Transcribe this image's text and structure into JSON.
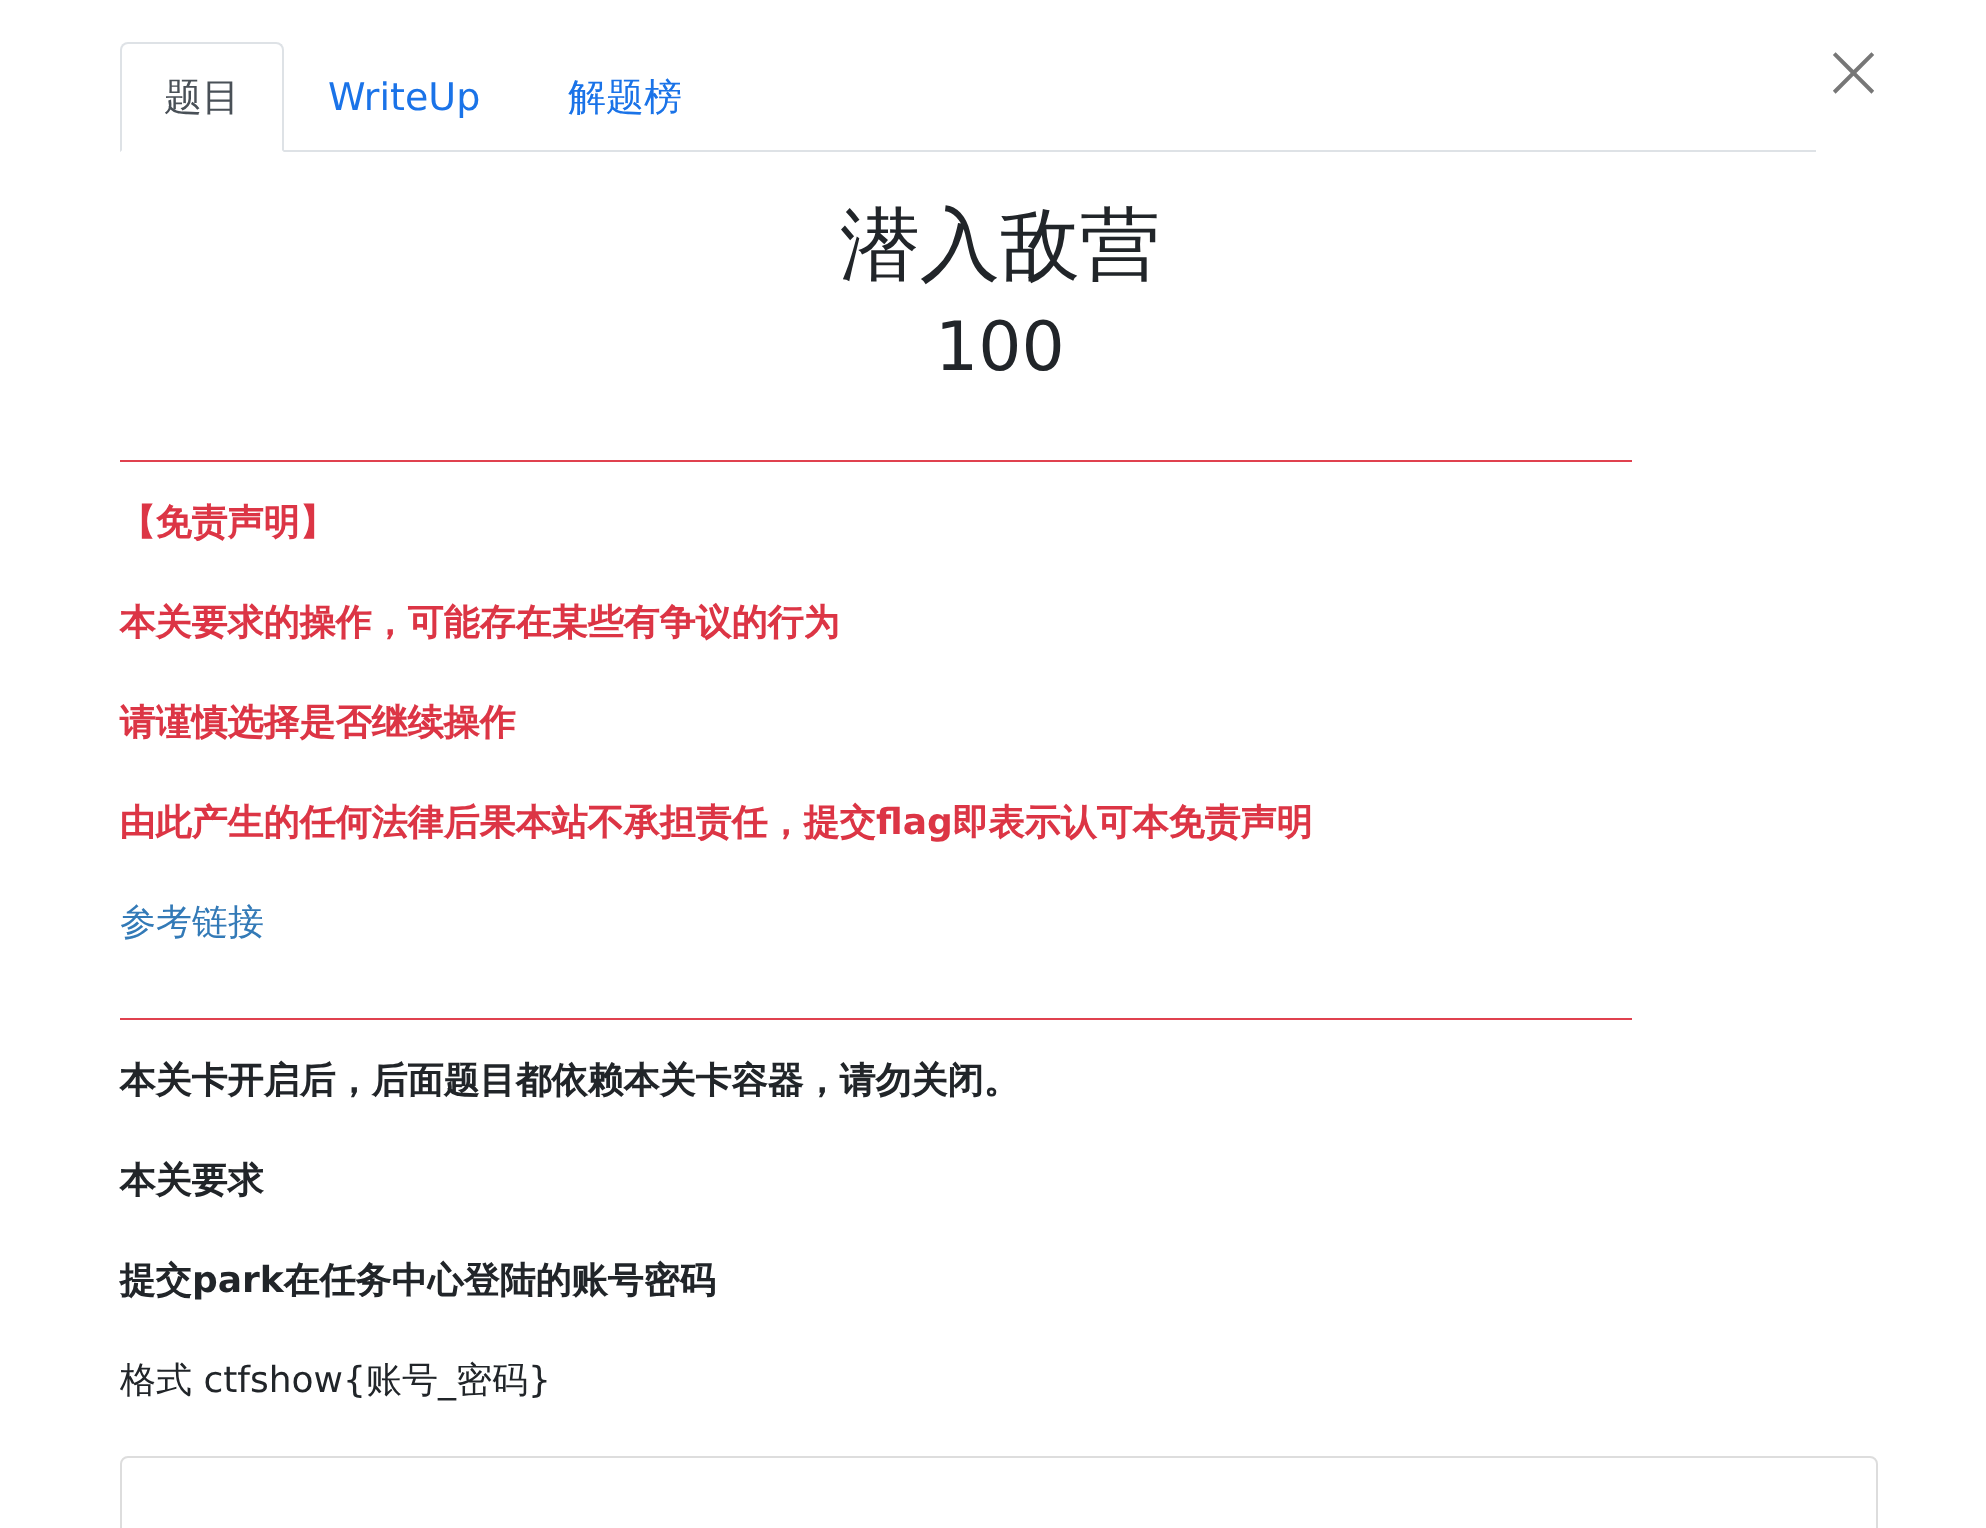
{
  "tabs": [
    {
      "label": "题目",
      "selected": true
    },
    {
      "label": "WriteUp",
      "selected": false
    },
    {
      "label": "解题榜",
      "selected": false
    }
  ],
  "close": "×",
  "challenge": {
    "title": "潜入敌营",
    "score": "100"
  },
  "disclaimer": [
    {
      "kind": "warning",
      "text": "【免责声明】"
    },
    {
      "kind": "warning",
      "text": "本关要求的操作，可能存在某些有争议的行为"
    },
    {
      "kind": "warning",
      "text": "请谨慎选择是否继续操作"
    },
    {
      "kind": "warning",
      "text": "由此产生的任何法律后果本站不承担责任，提交flag即表示认可本免责声明"
    },
    {
      "kind": "link",
      "text": "参考链接"
    }
  ],
  "description": [
    {
      "kind": "bold",
      "text": "本关卡开启后，后面题目都依赖本关卡容器，请勿关闭。"
    },
    {
      "kind": "bold",
      "text": "本关要求"
    },
    {
      "kind": "bold",
      "text": "提交park在任务中心登陆的账号密码"
    },
    {
      "kind": "plain",
      "text": "格式 ctfshow{账号_密码}"
    }
  ]
}
